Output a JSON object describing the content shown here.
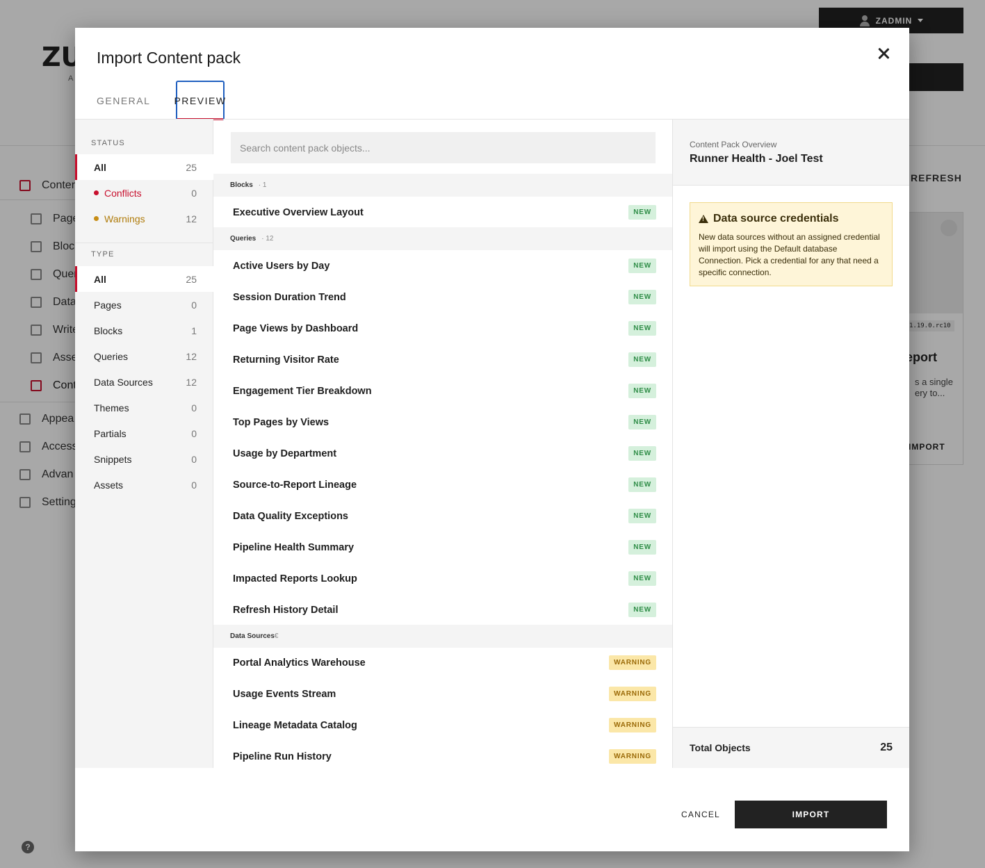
{
  "background": {
    "user_label": "ZADMIN",
    "logo_text": "ZU",
    "logo_sub": "A",
    "refresh_label": "REFRESH",
    "nav": [
      {
        "label": "Conter",
        "icon": "grid-icon"
      },
      {
        "label": "Page",
        "icon": "pages-icon"
      },
      {
        "label": "Bloc",
        "icon": "blocks-icon"
      },
      {
        "label": "Quer",
        "icon": "queries-icon"
      },
      {
        "label": "Data",
        "icon": "database-icon"
      },
      {
        "label": "Write",
        "icon": "writeback-icon"
      },
      {
        "label": "Asse",
        "icon": "assets-icon"
      },
      {
        "label": "Cont",
        "icon": "content-pack-icon"
      },
      {
        "label": "Appea",
        "icon": "appearance-icon"
      },
      {
        "label": "Access",
        "icon": "user-icon"
      },
      {
        "label": "Advan",
        "icon": "gear-icon"
      },
      {
        "label": "Setting",
        "icon": "settings-icon"
      }
    ],
    "card": {
      "version": "1.19.0.rc10",
      "title": "eport",
      "desc_line1": "s a single",
      "desc_line2": "ery to...",
      "action": "IMPORT"
    },
    "help": "?"
  },
  "modal": {
    "title": "Import Content pack",
    "tabs": {
      "general": "GENERAL",
      "preview": "PREVIEW"
    },
    "status": {
      "heading": "STATUS",
      "items": [
        {
          "label": "All",
          "count": "25"
        },
        {
          "label": "Conflicts",
          "count": "0"
        },
        {
          "label": "Warnings",
          "count": "12"
        }
      ]
    },
    "type": {
      "heading": "TYPE",
      "items": [
        {
          "label": "All",
          "count": "25"
        },
        {
          "label": "Pages",
          "count": "0"
        },
        {
          "label": "Blocks",
          "count": "1"
        },
        {
          "label": "Queries",
          "count": "12"
        },
        {
          "label": "Data Sources",
          "count": "12"
        },
        {
          "label": "Themes",
          "count": "0"
        },
        {
          "label": "Partials",
          "count": "0"
        },
        {
          "label": "Snippets",
          "count": "0"
        },
        {
          "label": "Assets",
          "count": "0"
        }
      ]
    },
    "search": {
      "placeholder": "Search content pack objects..."
    },
    "groups": {
      "blocks": {
        "name": "Blocks",
        "count": "· 1"
      },
      "queries": {
        "name": "Queries",
        "count": "· 12"
      },
      "datasources": {
        "name": "Data Sources",
        "count": "€"
      }
    },
    "blocks": [
      {
        "name": "Executive Overview Layout",
        "badge": "NEW"
      }
    ],
    "queries": [
      {
        "name": "Active Users by Day",
        "badge": "NEW"
      },
      {
        "name": "Session Duration Trend",
        "badge": "NEW"
      },
      {
        "name": "Page Views by Dashboard",
        "badge": "NEW"
      },
      {
        "name": "Returning Visitor Rate",
        "badge": "NEW"
      },
      {
        "name": "Engagement Tier Breakdown",
        "badge": "NEW"
      },
      {
        "name": "Top Pages by Views",
        "badge": "NEW"
      },
      {
        "name": "Usage by Department",
        "badge": "NEW"
      },
      {
        "name": "Source-to-Report Lineage",
        "badge": "NEW"
      },
      {
        "name": "Data Quality Exceptions",
        "badge": "NEW"
      },
      {
        "name": "Pipeline Health Summary",
        "badge": "NEW"
      },
      {
        "name": "Impacted Reports Lookup",
        "badge": "NEW"
      },
      {
        "name": "Refresh History Detail",
        "badge": "NEW"
      }
    ],
    "datasources": [
      {
        "name": "Portal Analytics Warehouse",
        "badge": "WARNING"
      },
      {
        "name": "Usage Events Stream",
        "badge": "WARNING"
      },
      {
        "name": "Lineage Metadata Catalog",
        "badge": "WARNING"
      },
      {
        "name": "Pipeline Run History",
        "badge": "WARNING"
      }
    ],
    "overview": {
      "subtitle": "Content Pack Overview",
      "title": "Runner Health - Joel Test",
      "alert_title": "Data source credentials",
      "alert_text": "New data sources without an assigned credential will import using the Default database Connection. Pick a credential for any that need a specific connection.",
      "total_label": "Total Objects",
      "total_value": "25"
    },
    "footer": {
      "cancel": "CANCEL",
      "import": "IMPORT"
    }
  },
  "colors": {
    "accent": "#c8102e",
    "warning": "#c78d15",
    "new_badge": "#d5f0dc",
    "warning_badge": "#fbe7a8"
  }
}
